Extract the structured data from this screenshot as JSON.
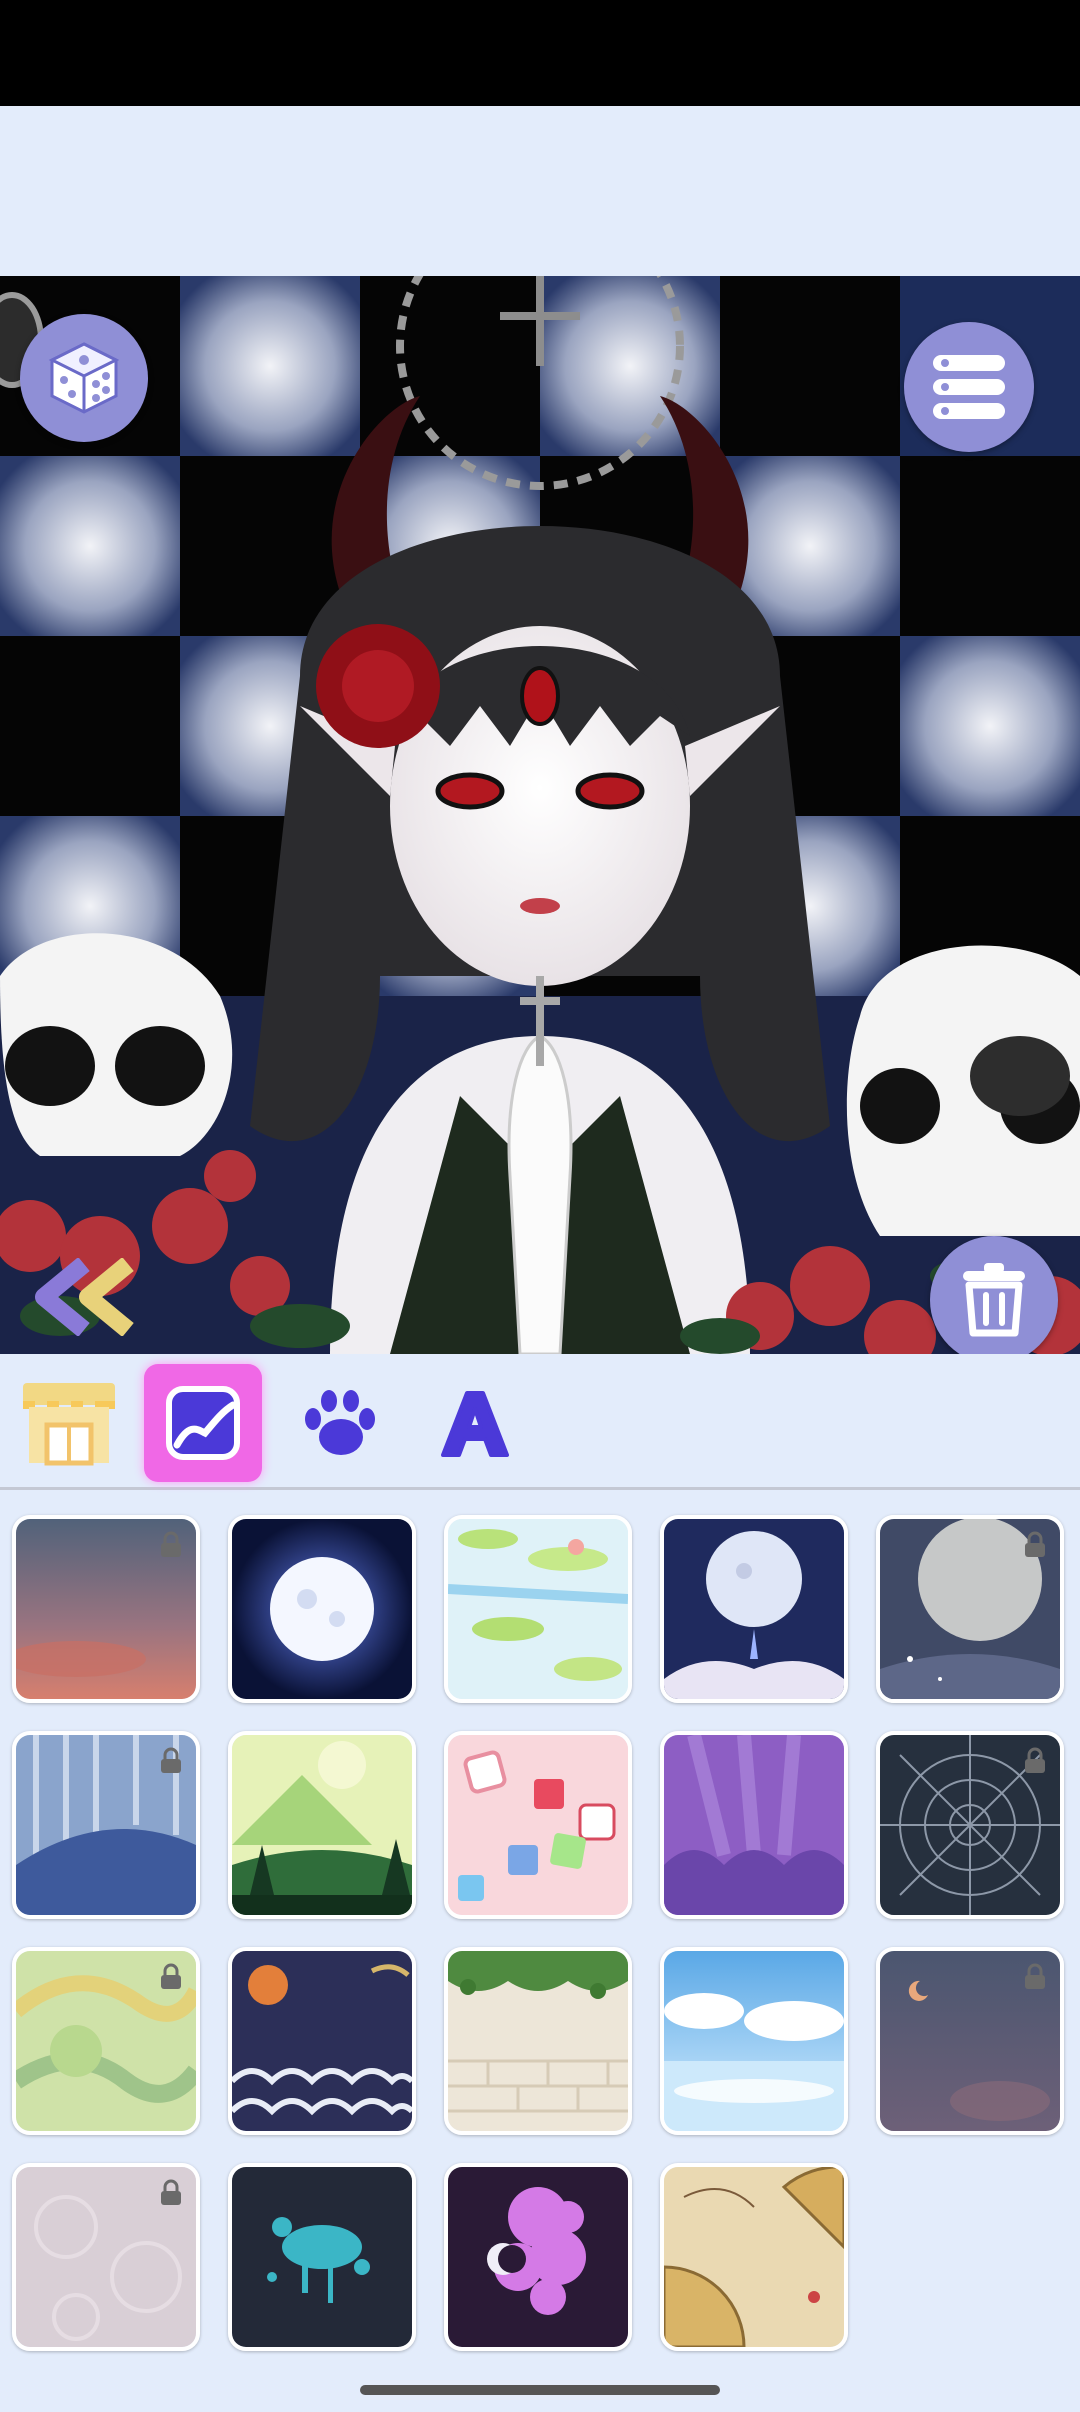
{
  "app": {
    "screen": "background-editor"
  },
  "toolbar": {
    "tools": [
      {
        "name": "shop-icon",
        "selected": false
      },
      {
        "name": "background-icon",
        "selected": true
      },
      {
        "name": "pet-paw-icon",
        "selected": false
      },
      {
        "name": "text-a-icon",
        "selected": false
      }
    ],
    "selected_color": "#f068e6",
    "accent": "#4b39d8"
  },
  "canvas": {
    "buttons": [
      "dice-icon",
      "menu-list-icon",
      "trash-icon",
      "double-chevron-left-icon"
    ]
  },
  "backgrounds": [
    {
      "id": "dusk-sky",
      "locked": true
    },
    {
      "id": "full-moon-night",
      "locked": false
    },
    {
      "id": "lily-pond",
      "locked": false
    },
    {
      "id": "moon-crystal-night",
      "locked": false
    },
    {
      "id": "grey-moon-stars",
      "locked": true
    },
    {
      "id": "blue-bamboo-forest",
      "locked": true
    },
    {
      "id": "green-mountain-pines",
      "locked": false
    },
    {
      "id": "pink-dice-pattern",
      "locked": false
    },
    {
      "id": "purple-clouds-rays",
      "locked": false
    },
    {
      "id": "spider-web",
      "locked": true
    },
    {
      "id": "golden-green-swirls",
      "locked": true
    },
    {
      "id": "japanese-waves-sunset",
      "locked": false
    },
    {
      "id": "ivy-brick-wall",
      "locked": false
    },
    {
      "id": "cloud-sea-sky",
      "locked": false
    },
    {
      "id": "crescent-night-haze",
      "locked": true
    },
    {
      "id": "pale-pink-texture",
      "locked": true
    },
    {
      "id": "teal-splatter",
      "locked": false
    },
    {
      "id": "purple-bubbles",
      "locked": false
    },
    {
      "id": "golden-fans",
      "locked": false
    }
  ]
}
